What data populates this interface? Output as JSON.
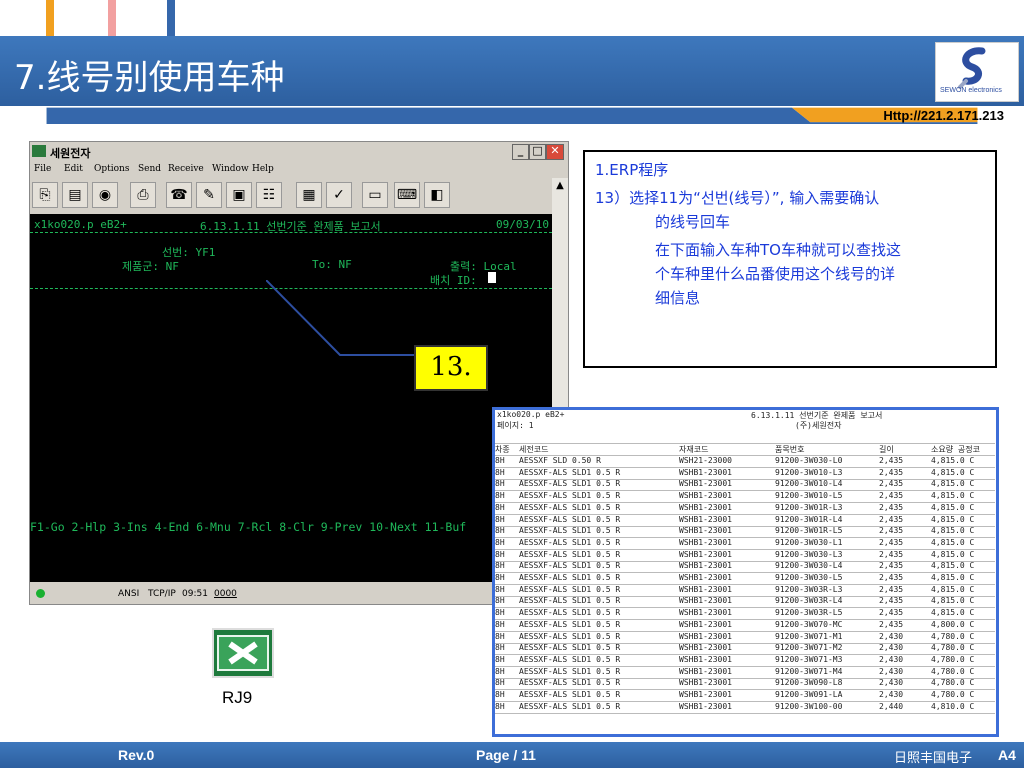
{
  "slide": {
    "title": "7.线号别使用车种",
    "logo_text": "SEWON electronics",
    "url": "Http://221.2.171.213"
  },
  "colors": {
    "header_blue": "#3567ab",
    "terminal_green": "#1fb85a",
    "callout_yellow": "#ffff00",
    "notes_text": "#1a3ad9",
    "url_band": "#f1a020"
  },
  "window": {
    "title": "세원전자",
    "menu": [
      "File",
      "Edit",
      "Options",
      "Send",
      "Receive",
      "Window",
      "Help"
    ],
    "toolbar_icons": [
      "copy-icon",
      "paste-icon",
      "camera-icon",
      "print-icon",
      "phone-icon",
      "pen-icon",
      "doc-icon",
      "tree-icon",
      "stamp-icon",
      "spell-icon",
      "monitor-icon",
      "keyboard-icon",
      "card-icon"
    ],
    "terminal": {
      "line1_left": "x1ko020.p eB2+",
      "line1_mid": "6.13.1.11 선번기준 완제품 보고서",
      "line1_right": "09/03/10",
      "field_line": "선번: YF1",
      "product_label": "제품군: NF",
      "to_label": "To: NF",
      "output_label": "출력: Local",
      "batch_label": "배치 ID:",
      "fkeys": "F1-Go 2-Hlp 3-Ins 4-End 6-Mnu 7-Rcl 8-Clr 9-Prev 10-Next 11-Buf"
    },
    "status": {
      "ansi": "ANSI",
      "tcpip": "TCP/IP",
      "time": "09:51",
      "code": "0000"
    }
  },
  "callout": {
    "label": "13."
  },
  "notes": {
    "line1": "1.ERP程序",
    "line2": "13）选择11为“선번(线号）”, 输入需要确认",
    "line3": "的线号回车",
    "line4": "在下面输入车种TO车种就可以查找这",
    "line5": "个车种里什么品番使用这个线号的详",
    "line6": "细信息"
  },
  "report": {
    "head_left": "x1ko020.p eB2+",
    "head_left2": "페이지:  1",
    "head_center": "6.13.1.11 선번기준 완제품 보고서",
    "head_center2": "(주)세원전자",
    "columns": [
      "차종",
      "세전코드",
      "자재코드",
      "품목번호",
      "길이",
      "소요량 공정코"
    ],
    "rows": [
      [
        "8H",
        "AESSXF SLD 0.50 R",
        "WSH21-23000",
        "91200-3W030-L0",
        "2,435",
        "4,815.0 C"
      ],
      [
        "8H",
        "AESSXF-ALS SLD1 0.5 R",
        "WSHB1-23001",
        "91200-3W010-L3",
        "2,435",
        "4,815.0 C"
      ],
      [
        "8H",
        "AESSXF-ALS SLD1 0.5 R",
        "WSHB1-23001",
        "91200-3W010-L4",
        "2,435",
        "4,815.0 C"
      ],
      [
        "8H",
        "AESSXF-ALS SLD1 0.5 R",
        "WSHB1-23001",
        "91200-3W010-L5",
        "2,435",
        "4,815.0 C"
      ],
      [
        "8H",
        "AESSXF-ALS SLD1 0.5 R",
        "WSHB1-23001",
        "91200-3W01R-L3",
        "2,435",
        "4,815.0 C"
      ],
      [
        "8H",
        "AESSXF-ALS SLD1 0.5 R",
        "WSHB1-23001",
        "91200-3W01R-L4",
        "2,435",
        "4,815.0 C"
      ],
      [
        "8H",
        "AESSXF-ALS SLD1 0.5 R",
        "WSHB1-23001",
        "91200-3W01R-L5",
        "2,435",
        "4,815.0 C"
      ],
      [
        "8H",
        "AESSXF-ALS SLD1 0.5 R",
        "WSHB1-23001",
        "91200-3W030-L1",
        "2,435",
        "4,815.0 C"
      ],
      [
        "8H",
        "AESSXF-ALS SLD1 0.5 R",
        "WSHB1-23001",
        "91200-3W030-L3",
        "2,435",
        "4,815.0 C"
      ],
      [
        "8H",
        "AESSXF-ALS SLD1 0.5 R",
        "WSHB1-23001",
        "91200-3W030-L4",
        "2,435",
        "4,815.0 C"
      ],
      [
        "8H",
        "AESSXF-ALS SLD1 0.5 R",
        "WSHB1-23001",
        "91200-3W030-L5",
        "2,435",
        "4,815.0 C"
      ],
      [
        "8H",
        "AESSXF-ALS SLD1 0.5 R",
        "WSHB1-23001",
        "91200-3W03R-L3",
        "2,435",
        "4,815.0 C"
      ],
      [
        "8H",
        "AESSXF-ALS SLD1 0.5 R",
        "WSHB1-23001",
        "91200-3W03R-L4",
        "2,435",
        "4,815.0 C"
      ],
      [
        "8H",
        "AESSXF-ALS SLD1 0.5 R",
        "WSHB1-23001",
        "91200-3W03R-L5",
        "2,435",
        "4,815.0 C"
      ],
      [
        "8H",
        "AESSXF-ALS SLD1 0.5 R",
        "WSHB1-23001",
        "91200-3W070-MC",
        "2,435",
        "4,800.0 C"
      ],
      [
        "8H",
        "AESSXF-ALS SLD1 0.5 R",
        "WSHB1-23001",
        "91200-3W071-M1",
        "2,430",
        "4,780.0 C"
      ],
      [
        "8H",
        "AESSXF-ALS SLD1 0.5 R",
        "WSHB1-23001",
        "91200-3W071-M2",
        "2,430",
        "4,780.0 C"
      ],
      [
        "8H",
        "AESSXF-ALS SLD1 0.5 R",
        "WSHB1-23001",
        "91200-3W071-M3",
        "2,430",
        "4,780.0 C"
      ],
      [
        "8H",
        "AESSXF-ALS SLD1 0.5 R",
        "WSHB1-23001",
        "91200-3W071-M4",
        "2,430",
        "4,780.0 C"
      ],
      [
        "8H",
        "AESSXF-ALS SLD1 0.5 R",
        "WSHB1-23001",
        "91200-3W090-L8",
        "2,430",
        "4,780.0 C"
      ],
      [
        "8H",
        "AESSXF-ALS SLD1 0.5 R",
        "WSHB1-23001",
        "91200-3W091-LA",
        "2,430",
        "4,780.0 C"
      ],
      [
        "8H",
        "AESSXF-ALS SLD1 0.5 R",
        "WSHB1-23001",
        "91200-3W100-00",
        "2,440",
        "4,810.0 C"
      ]
    ]
  },
  "excel": {
    "label": "RJ9"
  },
  "footer": {
    "rev": "Rev.0",
    "page": "Page / 11",
    "company": "日照丰国电子",
    "size": "A4"
  }
}
